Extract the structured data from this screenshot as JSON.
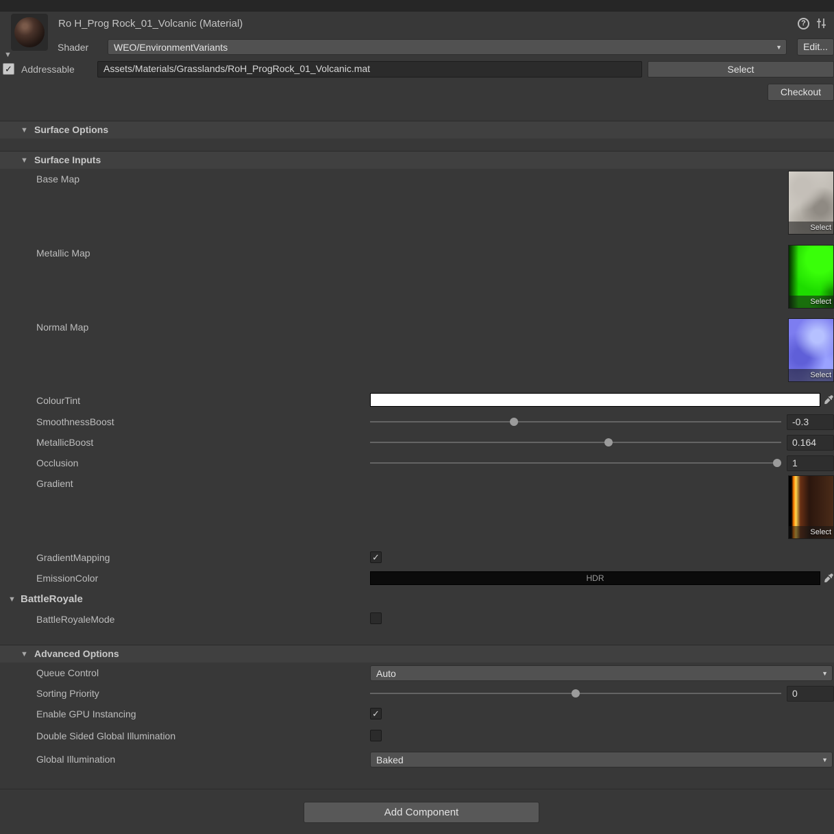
{
  "icons": {
    "foldout_open": "▼",
    "chevron_down": "▼",
    "check": "✓",
    "help": "?"
  },
  "header": {
    "title": "Ro H_Prog Rock_01_Volcanic (Material)",
    "shader": {
      "label": "Shader",
      "value": "WEO/EnvironmentVariants",
      "edit_button": "Edit..."
    },
    "addressable": {
      "label": "Addressable",
      "path": "Assets/Materials/Grasslands/RoH_ProgRock_01_Volcanic.mat",
      "select_button": "Select"
    },
    "checkout_button": "Checkout"
  },
  "sections": {
    "surface_options": {
      "title": "Surface Options"
    },
    "surface_inputs": {
      "title": "Surface Inputs",
      "base_map": {
        "label": "Base Map",
        "select_button": "Select"
      },
      "metallic_map": {
        "label": "Metallic Map",
        "select_button": "Select"
      },
      "normal_map": {
        "label": "Normal Map",
        "select_button": "Select"
      },
      "colour_tint": {
        "label": "ColourTint",
        "color": "#ffffff"
      },
      "smoothness_boost": {
        "label": "SmoothnessBoost",
        "value": "-0.3",
        "handle_style": "left:35%"
      },
      "metallic_boost": {
        "label": "MetallicBoost",
        "value": "0.164",
        "handle_style": "left:58%"
      },
      "occlusion": {
        "label": "Occlusion",
        "value": "1",
        "handle_style": "left:99%"
      },
      "gradient": {
        "label": "Gradient",
        "select_button": "Select"
      },
      "gradient_mapping": {
        "label": "GradientMapping",
        "checked": true
      },
      "emission_color": {
        "label": "EmissionColor",
        "badge": "HDR",
        "color": "#000000"
      }
    },
    "battle_royale": {
      "title": "BattleRoyale",
      "mode": {
        "label": "BattleRoyaleMode",
        "checked": false
      }
    },
    "advanced_options": {
      "title": "Advanced Options",
      "queue_control": {
        "label": "Queue Control",
        "value": "Auto"
      },
      "sorting_priority": {
        "label": "Sorting Priority",
        "value": "0",
        "handle_style": "left:50%"
      },
      "gpu_instancing": {
        "label": "Enable GPU Instancing",
        "checked": true
      },
      "double_sided_gi": {
        "label": "Double Sided Global Illumination",
        "checked": false
      },
      "global_illumination": {
        "label": "Global Illumination",
        "value": "Baked"
      }
    }
  },
  "footer": {
    "add_component_button": "Add Component"
  }
}
